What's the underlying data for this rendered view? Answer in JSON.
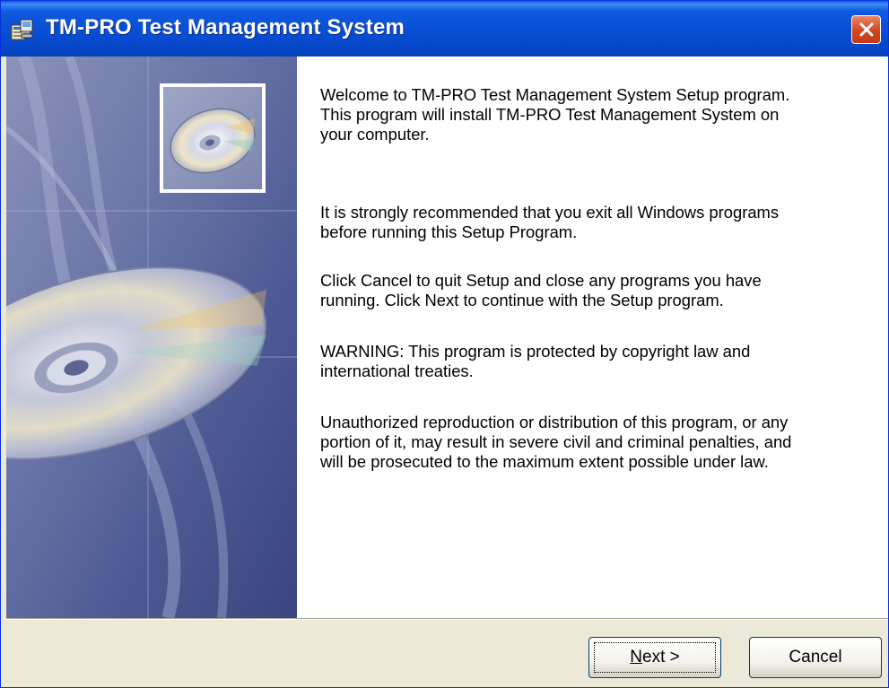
{
  "window": {
    "title": "TM-PRO Test Management System"
  },
  "content": {
    "paragraphs": [
      "Welcome to TM-PRO Test Management System Setup program.\nThis program will install TM-PRO Test Management System on\nyour computer.",
      "It is strongly recommended that you exit all Windows programs\nbefore running this Setup Program.",
      "Click Cancel to quit Setup and close any programs you have\nrunning.  Click Next to continue with the Setup program.",
      "WARNING: This program is protected by copyright law and\ninternational treaties.",
      "Unauthorized reproduction or distribution of this program, or any\nportion of it, may result in severe civil and criminal penalties, and\nwill be prosecuted to the maximum extent possible under law."
    ]
  },
  "buttons": {
    "next_mnemonic": "N",
    "next_rest": "ext >",
    "cancel": "Cancel"
  },
  "icons": {
    "app": "installer-icon",
    "close": "close-icon",
    "banner": "cd-disc-icon"
  },
  "colors": {
    "titlebar": "#0A4FD6",
    "close": "#D4441E",
    "dialog_bg": "#ECE9D8",
    "banner": "#5C6BA8"
  }
}
